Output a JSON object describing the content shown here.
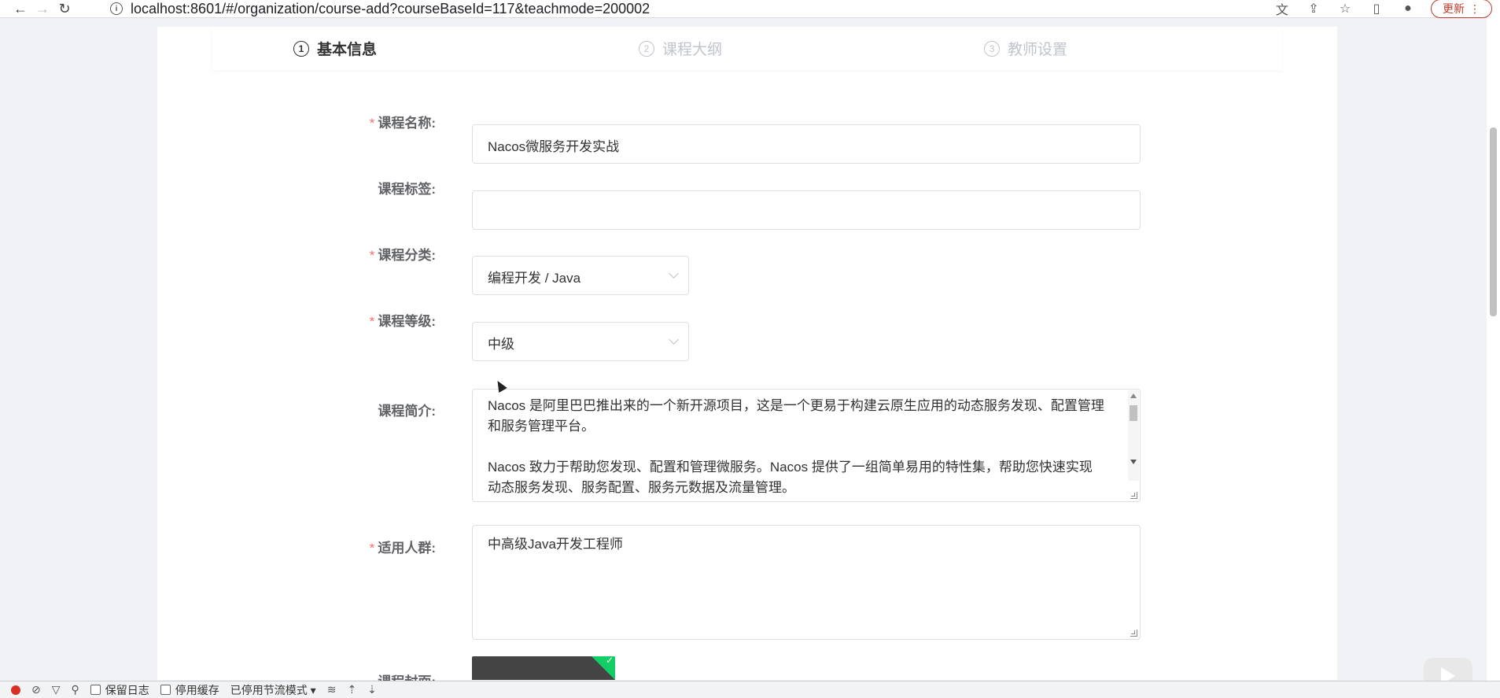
{
  "browser": {
    "url": "localhost:8601/#/organization/course-add?courseBaseId=117&teachmode=200002",
    "update_label": "更新"
  },
  "steps": [
    {
      "num": "1",
      "label": "基本信息",
      "active": true
    },
    {
      "num": "2",
      "label": "课程大纲",
      "active": false
    },
    {
      "num": "3",
      "label": "教师设置",
      "active": false
    }
  ],
  "form": {
    "name": {
      "label": "课程名称:",
      "value": "Nacos微服务开发实战",
      "required": true
    },
    "tags": {
      "label": "课程标签:",
      "value": "",
      "required": false
    },
    "category": {
      "label": "课程分类:",
      "value": "编程开发 / Java",
      "required": true
    },
    "grade": {
      "label": "课程等级:",
      "value": "中级",
      "required": true
    },
    "intro": {
      "label": "课程简介:",
      "paragraph1": "Nacos 是阿里巴巴推出来的一个新开源项目，这是一个更易于构建云原生应用的动态服务发现、配置管理和服务管理平台。",
      "paragraph2": "Nacos 致力于帮助您发现、配置和管理微服务。Nacos 提供了一组简单易用的特性集，帮助您快速实现动态服务发现、服务配置、服务元数据及流量管理。"
    },
    "audience": {
      "label": "适用人群:",
      "value": "中高级Java开发工程师",
      "required": true
    },
    "cover": {
      "label": "课程封面:",
      "required": false
    }
  },
  "devtools": {
    "preserve_log": "保留日志",
    "disable_cache": "停用缓存",
    "throttle": "已停用节流模式"
  }
}
